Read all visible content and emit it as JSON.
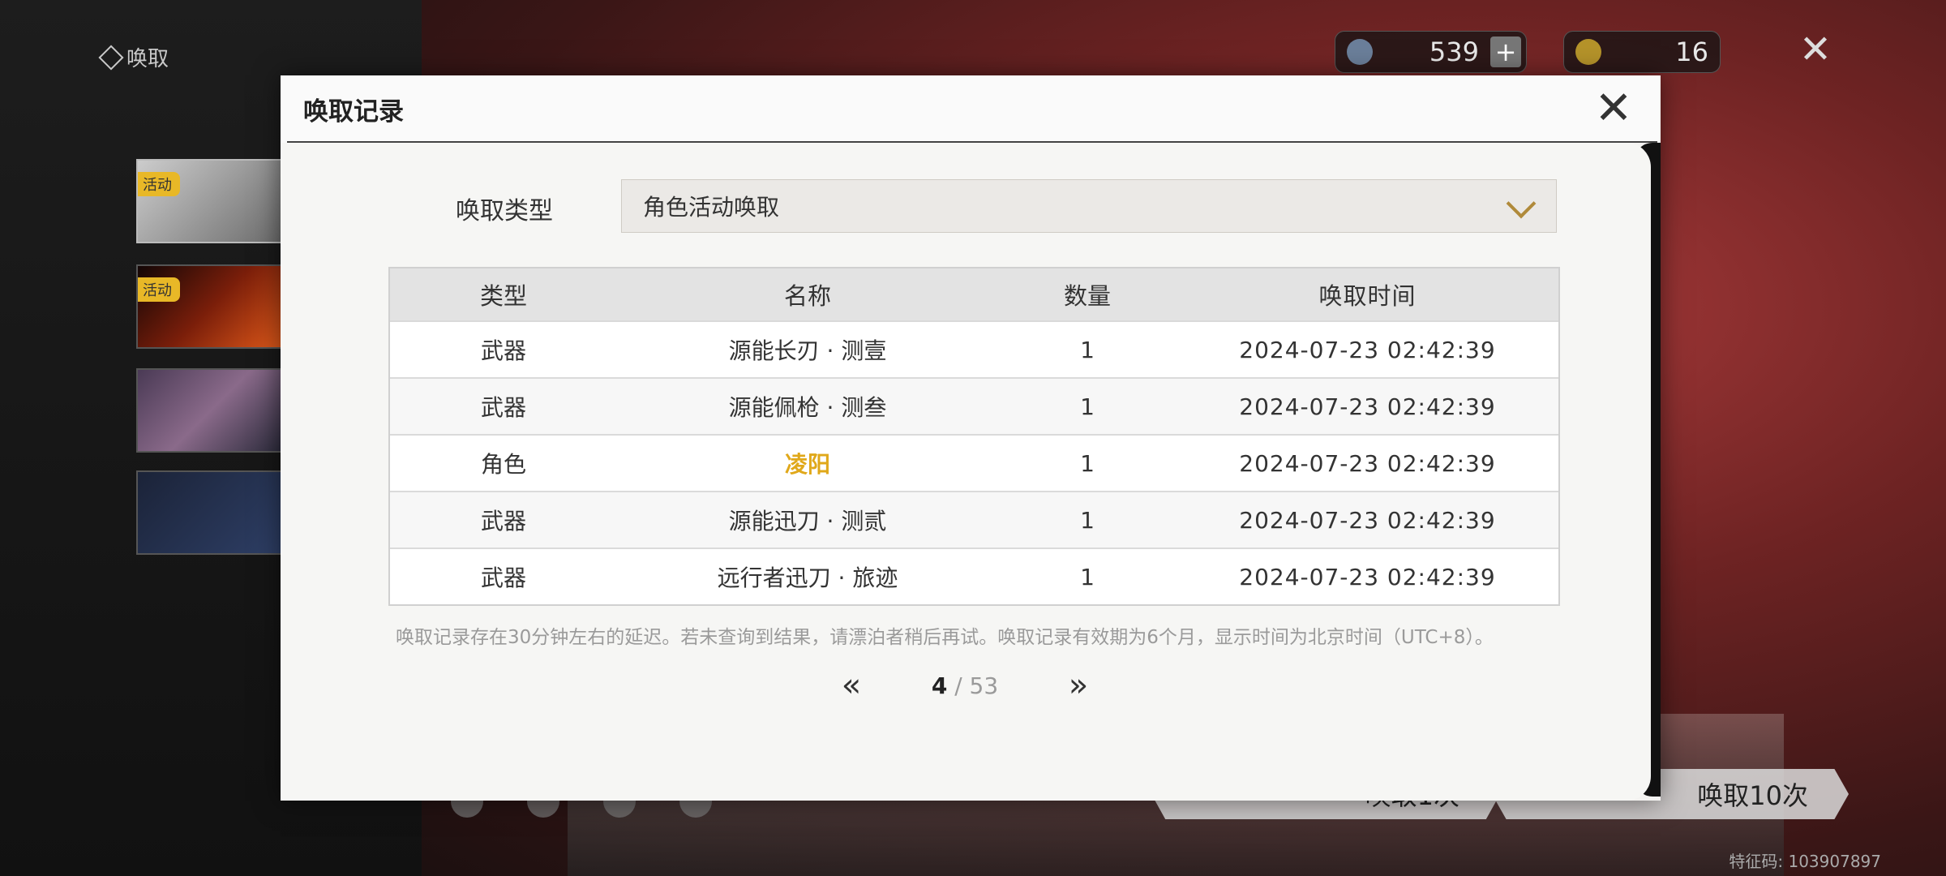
{
  "app": {
    "title": "唤取"
  },
  "currency": [
    {
      "icon": "astrite-icon",
      "value": "539",
      "plus": "+"
    },
    {
      "icon": "lustrous-tide-icon",
      "value": "16"
    }
  ],
  "banners": [
    {
      "tag": "活动"
    },
    {
      "tag": "活动"
    },
    {
      "tag": ""
    },
    {
      "tag": ""
    }
  ],
  "pull_buttons": {
    "single": "唤取1次",
    "ten": "唤取10次"
  },
  "character_id": "特征码: 103907897",
  "modal": {
    "title": "唤取记录",
    "type_label": "唤取类型",
    "type_value": "角色活动唤取",
    "headers": [
      "类型",
      "名称",
      "数量",
      "唤取时间"
    ],
    "rows": [
      {
        "type": "武器",
        "name": "源能长刃 · 测壹",
        "qty": "1",
        "time": "2024-07-23 02:42:39",
        "rarity": "normal"
      },
      {
        "type": "武器",
        "name": "源能佩枪 · 测叁",
        "qty": "1",
        "time": "2024-07-23 02:42:39",
        "rarity": "normal"
      },
      {
        "type": "角色",
        "name": "凌阳",
        "qty": "1",
        "time": "2024-07-23 02:42:39",
        "rarity": "gold"
      },
      {
        "type": "武器",
        "name": "源能迅刀 · 测贰",
        "qty": "1",
        "time": "2024-07-23 02:42:39",
        "rarity": "normal"
      },
      {
        "type": "武器",
        "name": "远行者迅刀 · 旅迹",
        "qty": "1",
        "time": "2024-07-23 02:42:39",
        "rarity": "normal"
      }
    ],
    "note": "唤取记录存在30分钟左右的延迟。若未查询到结果，请漂泊者稍后再试。唤取记录有效期为6个月，显示时间为北京时间（UTC+8）。",
    "pager": {
      "current": "4",
      "separator": " / ",
      "total": "53",
      "prev": "«",
      "next": "»"
    }
  },
  "colors": {
    "gold": "#e0a81a",
    "accent": "#b08a3a",
    "background": "#6e2323"
  }
}
